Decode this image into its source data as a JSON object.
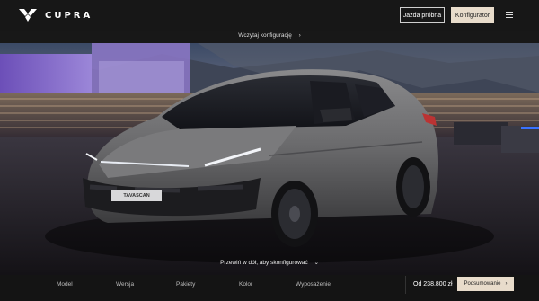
{
  "header": {
    "brand": "CUPRA",
    "test_drive_label": "Jazda próbna",
    "configurator_label": "Konfigurator"
  },
  "subbar": {
    "load_config_label": "Wczytaj konfigurację",
    "load_config_arrow": "›"
  },
  "scene": {
    "plate_text": "TAVASCAN",
    "scroll_hint": "Przewiń w dół, aby skonfigurować",
    "scroll_arrow": "⌄"
  },
  "nav": {
    "items": [
      "Model",
      "Wersja",
      "Pakiety",
      "Kolor",
      "Wyposażenie"
    ]
  },
  "footer": {
    "price": "Od 238.800 zł",
    "summary_label": "Podsumowanie",
    "summary_arrow": "›"
  },
  "colors": {
    "header_bg": "#171717",
    "accent_button": "#e8dccb",
    "car_body": "#6f6f71"
  },
  "icons": {
    "logo": "cupra-logo-icon",
    "menu": "hamburger-menu-icon"
  }
}
